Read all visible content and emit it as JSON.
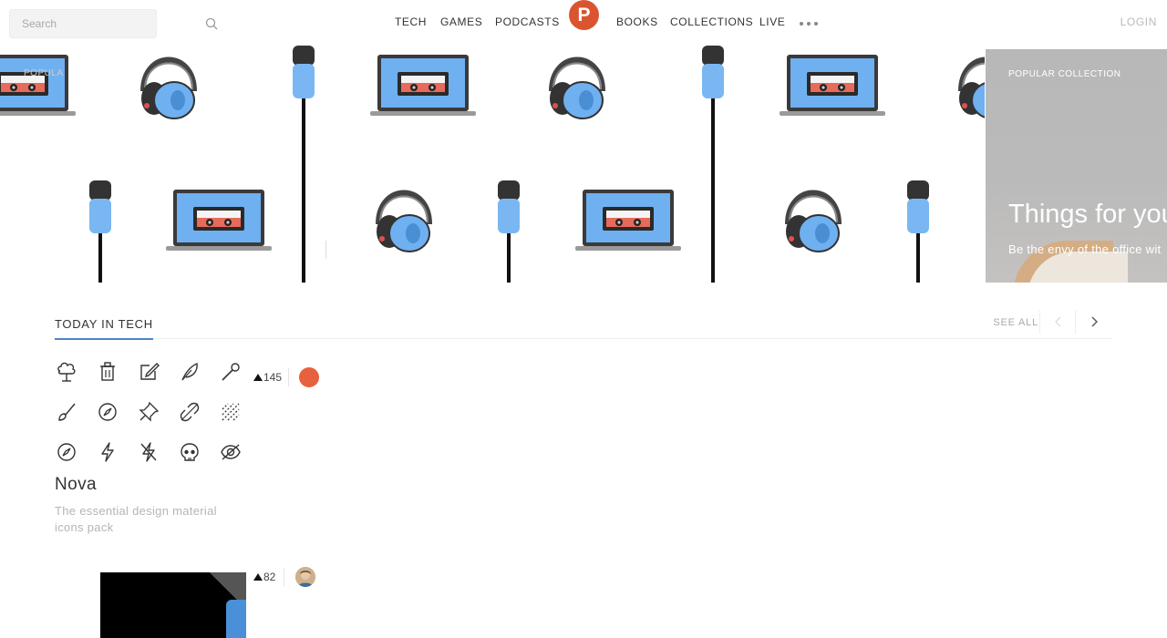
{
  "header": {
    "search_placeholder": "Search",
    "nav": [
      "TECH",
      "GAMES",
      "PODCASTS",
      "BOOKS",
      "COLLECTIONS",
      "LIVE"
    ],
    "logo_letter": "P",
    "login": "LOGIN",
    "brand_color": "#da552f"
  },
  "hero": {
    "faded_label": "POPULA",
    "right": {
      "label": "POPULAR COLLECTION",
      "title": "Things for you",
      "subtitle": "Be the envy of the office wit"
    }
  },
  "section": {
    "title": "TODAY IN TECH",
    "see_all": "SEE ALL",
    "accent": "#4b87c5"
  },
  "posts": [
    {
      "name": "Nova",
      "tagline": "The essential design material icons pack",
      "votes": "145",
      "icons": [
        "tree-icon",
        "trash-icon",
        "external-edit-icon",
        "feather-icon",
        "wand-icon",
        "brush-icon",
        "compass-icon",
        "pin-icon",
        "link-off-icon",
        "texture-icon",
        "explore-icon",
        "flash-icon",
        "flash-off-icon",
        "skull-icon",
        "eye-off-icon"
      ]
    },
    {
      "votes": "82"
    }
  ]
}
